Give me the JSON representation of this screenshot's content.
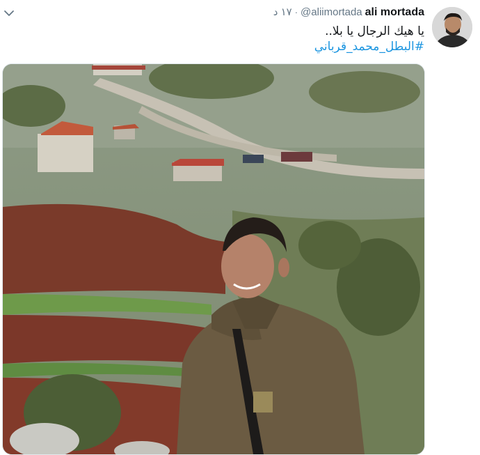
{
  "tweet": {
    "author_name": "ali mortada",
    "author_handle": "@aliimortada",
    "separator": "·",
    "time": "١٧ د",
    "text": "يا هيك الرجال يا بلا..",
    "hashtag": "#البطل_محمد_قرباني"
  },
  "icons": {
    "menu": "chevron-down-icon"
  },
  "colors": {
    "link": "#1b95e0",
    "secondary_text": "#657786",
    "primary_text": "#14171a"
  }
}
